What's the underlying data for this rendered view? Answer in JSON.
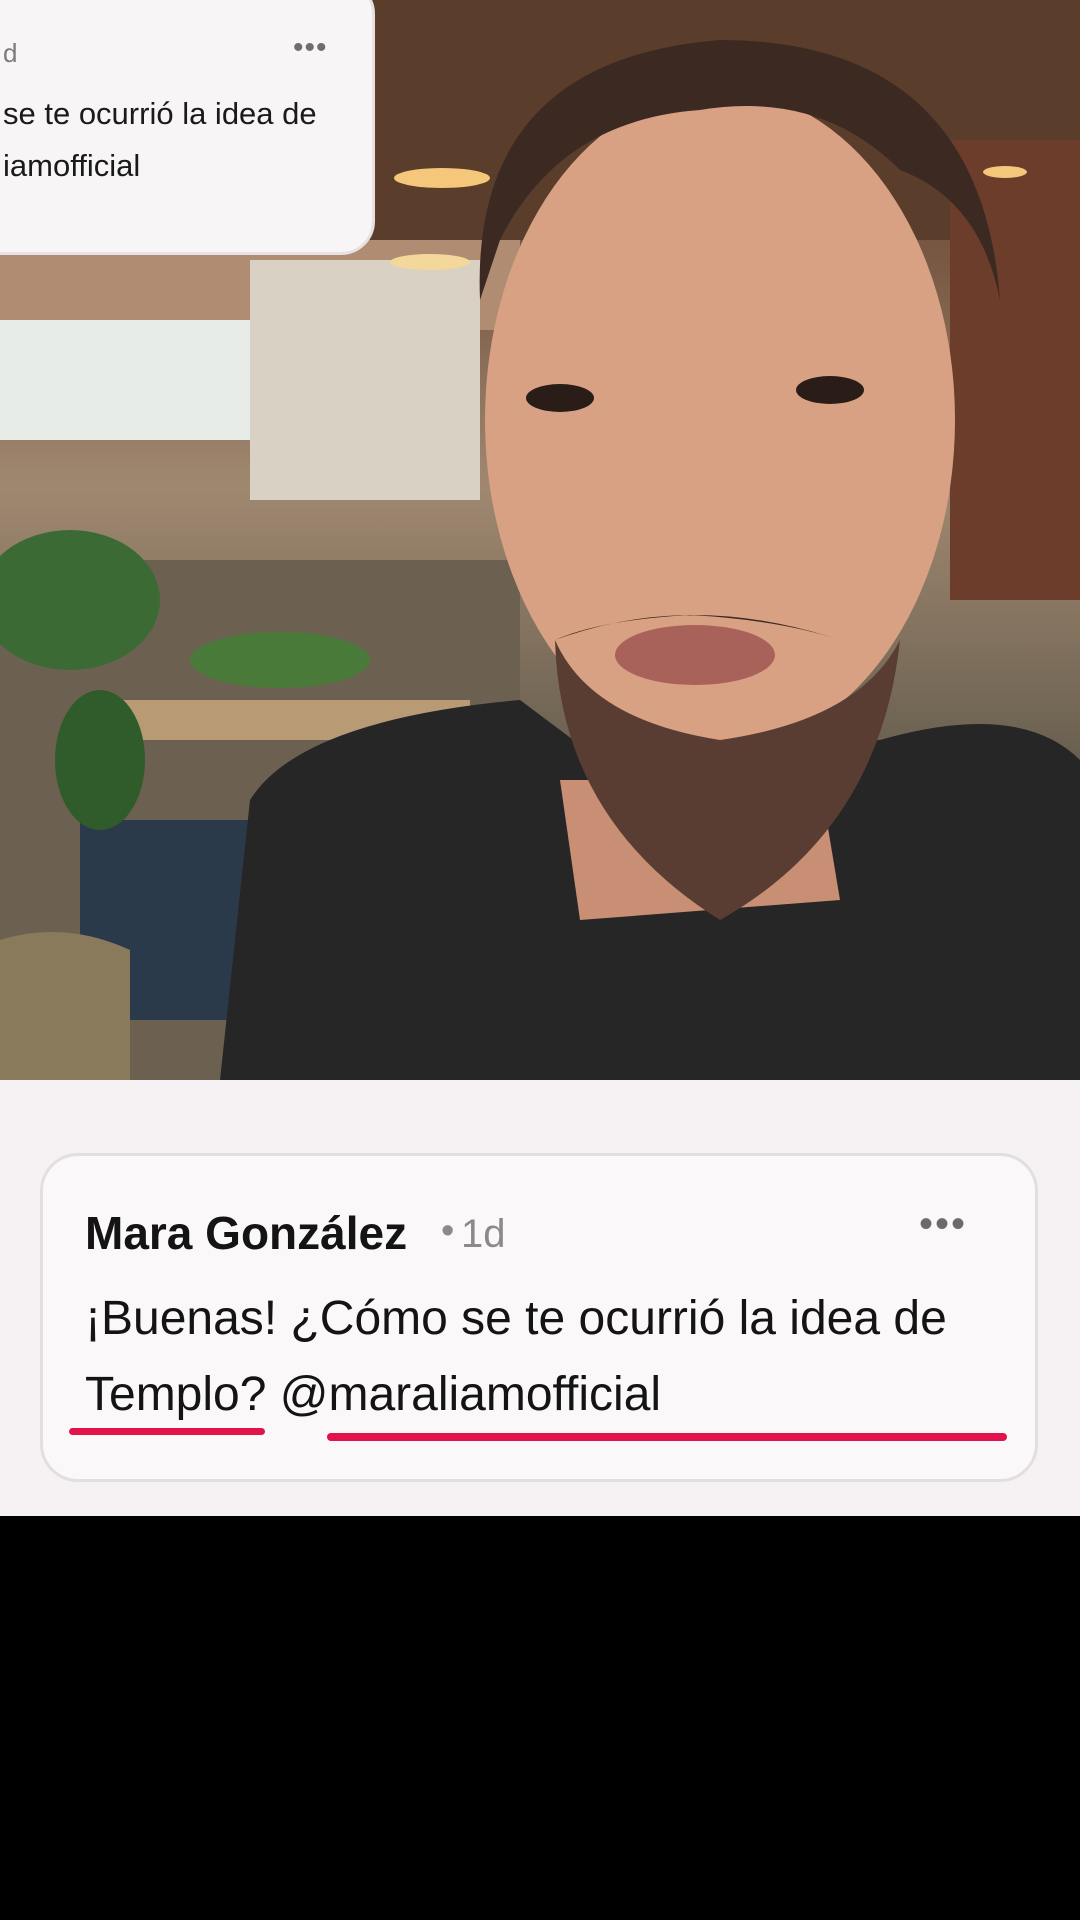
{
  "video": {
    "description_icon": "person-video-icon"
  },
  "top_comment": {
    "meta": "d",
    "more_label": "•••",
    "line1": "se te ocurrió la idea de",
    "line2": "iamofficial"
  },
  "comment": {
    "author": "Mara González",
    "separator": "•",
    "time": "1d",
    "more_label": "•••",
    "line1": "¡Buenas! ¿Cómo se te ocurrió la idea de",
    "line2": "Templo? @maraliamofficial"
  },
  "colors": {
    "highlight_underline": "#e0134a",
    "panel_background": "#f6f2f4",
    "card_background": "#faf8f9"
  }
}
